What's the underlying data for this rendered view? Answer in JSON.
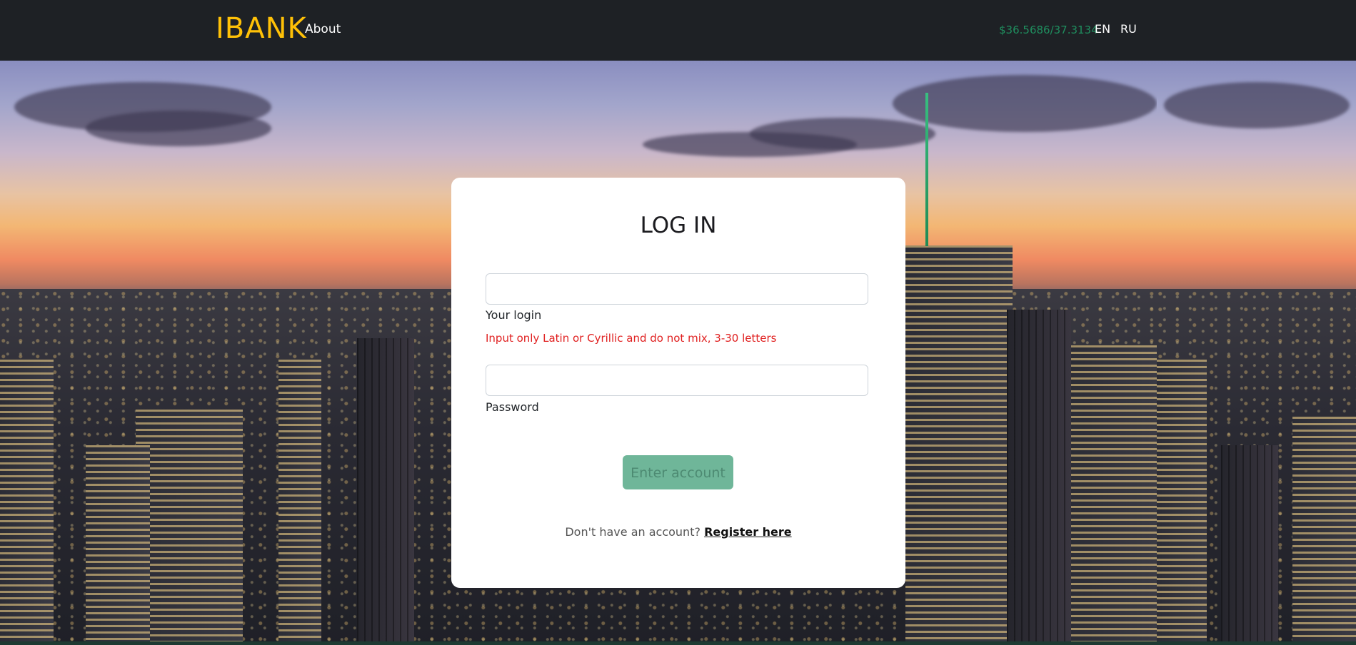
{
  "navbar": {
    "brand": "IBANK",
    "about_link": "About",
    "exchange_rate": "$36.5686/37.3134",
    "lang_en": "EN",
    "lang_ru": "RU"
  },
  "login_card": {
    "title": "LOG IN",
    "login_input_value": "",
    "login_label": "Your login",
    "login_error": "Input only Latin or Cyrillic and do not mix, 3-30 letters",
    "password_input_value": "",
    "password_label": "Password",
    "submit_button": "Enter account",
    "register_prompt": "Don't have an account?",
    "register_link": "Register here"
  },
  "colors": {
    "navbar_bg": "#1e2125",
    "brand": "#ffc107",
    "exchange_rate": "#1f8f5f",
    "error": "#e02020",
    "button_bg": "#6fb699"
  }
}
